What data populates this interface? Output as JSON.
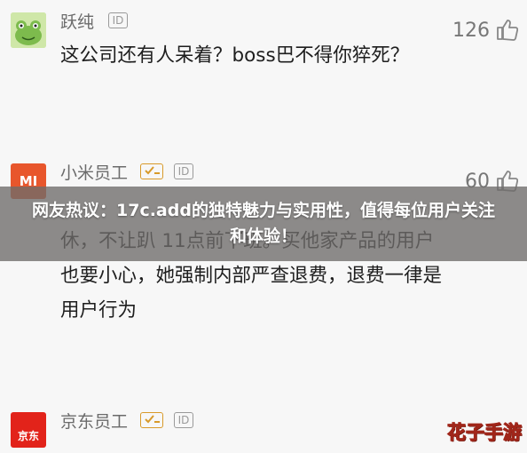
{
  "comments": [
    {
      "user": "跃纯",
      "badge": "ID",
      "likes": "126",
      "text": "这公司还有人呆着？boss巴不得你猝死？",
      "avatar_icon": "frog-avatar-icon"
    },
    {
      "user": "小米员工",
      "badge": "ID",
      "likes": "60",
      "text": "休，不让趴            11点前下班。买他家产品的用户也要小心，她强制内部严查退费，退费一律是用户行为",
      "avatar_label": "MI",
      "avatar_color": "#e8562c"
    },
    {
      "user": "京东员工",
      "badge": "ID",
      "avatar_label": "京东",
      "avatar_color": "#e2231a"
    }
  ],
  "banner": {
    "title": "网友热议：17c.add的独特魅力与实用性，值得每位用户关注和体验！"
  },
  "watermark": "花子手游",
  "colors": {
    "staff_badge": "#d89a2a",
    "banner_bg": "#6e6c6a",
    "watermark": "#ffd84a"
  }
}
